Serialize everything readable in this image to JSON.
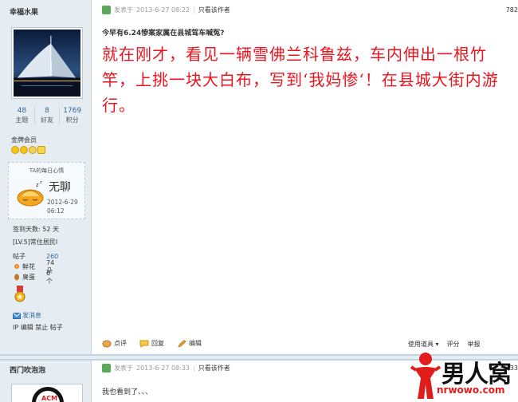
{
  "post1": {
    "username": "幸福水果",
    "stats": [
      {
        "num": "48",
        "label": "主题"
      },
      {
        "num": "8",
        "label": "好友"
      },
      {
        "num": "1769",
        "label": "积分"
      }
    ],
    "member_level": "金牌会员",
    "mood": {
      "title": "TA的每日心情",
      "text": "无聊",
      "date": "2012-6-29",
      "time": "06:12"
    },
    "checkin": "签到天数: 52 天",
    "rank": "[LV.5]常住居民I",
    "posts": {
      "label": "帖子",
      "value": "260"
    },
    "flowers": {
      "label": "鲜花",
      "value": "74 朵"
    },
    "eggs": {
      "label": "臭蛋",
      "value": "6 个"
    },
    "send_message": "发消息",
    "admin_links": "IP 编辑 禁止 帖子",
    "head": {
      "posted_prefix": "发表于",
      "datetime": "2013-6-27 08:22",
      "author_only": "只看该作者",
      "floor": "782"
    },
    "title": "今早有6.24惨案家属在县城驾车喊冤?",
    "body": "就在刚才，看见一辆雪佛兰科鲁兹，车内伸出一根竹竿，上挑一块大白布，写到‘我妈惨‘！在县城大街内游行。",
    "actions": [
      "点评",
      "回复",
      "编辑"
    ],
    "actions_right": [
      "使用道具 ▾",
      "评分",
      "举报"
    ]
  },
  "post2": {
    "username": "西门吹泡泡",
    "head": {
      "posted_prefix": "发表于",
      "datetime": "2013-6-27 08:33",
      "author_only": "只看该作者",
      "floor": "33"
    },
    "reply": "我也看到了、、、"
  },
  "watermark": {
    "text": "男人窝",
    "url": "nrwowo.com"
  },
  "colors": {
    "sidebar_bg": "#e5edf2",
    "body_red": "#e8141e",
    "link_blue": "#336699"
  }
}
